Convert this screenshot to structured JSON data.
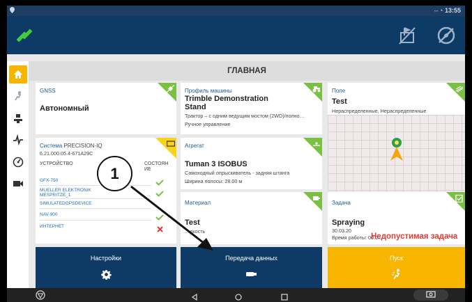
{
  "status_bar": {
    "left_icon": "location-pin-icon",
    "time": "13:55"
  },
  "app_bar": {
    "left_icon": "satellite-icon",
    "right_icons": [
      "field-flag-crossed-icon",
      "compass-crossed-icon"
    ]
  },
  "nav_rail": {
    "items": [
      "home-icon",
      "spray-icon",
      "gps-receiver-icon",
      "pulse-icon",
      "gauge-icon",
      "camera-icon"
    ]
  },
  "title": "ГЛАВНАЯ",
  "cards": {
    "gnss": {
      "caption": "GNSS",
      "value": "Автономный",
      "accent": "#7ac143"
    },
    "machine": {
      "caption": "Профиль машины",
      "name_line1": "Trimble Demonstration",
      "name_line2": "Stand",
      "desc": "Трактор – с одним ведущим мостом (2WD)/полно…",
      "steering": "Ручное управление",
      "accent": "#7ac143"
    },
    "field": {
      "caption": "Поле",
      "name": "Test",
      "desc": "Нераспределенные, Нераспределенные",
      "accent": "#7ac143"
    },
    "system": {
      "caption": "Система",
      "system_name": "PRECISION-IQ",
      "version": "6.21.000.05.4-671A29C",
      "col_device": "УСТРОЙСТВО",
      "col_status_1": "СОСТОЯН",
      "col_status_2": "ИЕ",
      "devices": [
        "GFX-750",
        "MUELLER ELEKTRONIK MESPRITZE_1",
        "SIMULATEDGPSDEVICE",
        "NAV-900",
        "ИНТЕРНЕТ"
      ],
      "accent": "#f7d418"
    },
    "implement": {
      "caption": "Агрегат",
      "name": "Tuman 3 ISOBUS",
      "desc": "Самоходный опрыскиватель - задняя штанга",
      "width": "Ширина полосы: 28.00 м",
      "accent": "#7ac143"
    },
    "material": {
      "caption": "Материал",
      "name": "Test",
      "detail": "…дкость",
      "accent": "#7ac143"
    },
    "task": {
      "caption": "Задача",
      "name": "Spraying",
      "date": "30.03.20",
      "work_time": "Время работы: 00.0…",
      "error": "Недопустимая задача",
      "accent": "#7ac143"
    }
  },
  "buttons": {
    "settings": "Настройки",
    "data_transfer": "Передача данных",
    "start": "Пуск"
  },
  "callout": "1"
}
